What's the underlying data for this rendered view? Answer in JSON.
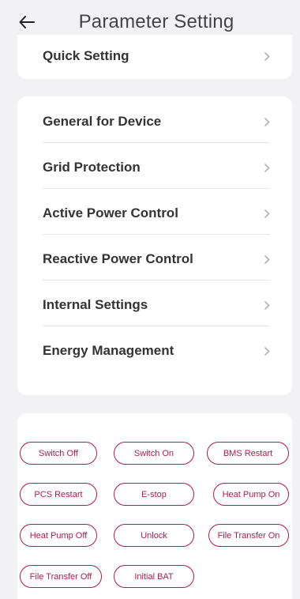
{
  "header": {
    "title": "Parameter Setting"
  },
  "quick_setting": {
    "label": "Quick Setting"
  },
  "menu": {
    "items": [
      {
        "label": "General for Device"
      },
      {
        "label": "Grid Protection"
      },
      {
        "label": "Active Power Control"
      },
      {
        "label": "Reactive Power Control"
      },
      {
        "label": "Internal Settings"
      },
      {
        "label": "Energy Management"
      }
    ]
  },
  "actions": {
    "buttons": [
      {
        "label": "Switch Off"
      },
      {
        "label": "Switch On"
      },
      {
        "label": "BMS Restart"
      },
      {
        "label": "PCS Restart"
      },
      {
        "label": "E-stop"
      },
      {
        "label": "Heat Pump On"
      },
      {
        "label": "Heat Pump Off"
      },
      {
        "label": "Unlock"
      },
      {
        "label": "File Transfer On"
      },
      {
        "label": "File Transfer Off"
      },
      {
        "label": "Initial BAT"
      }
    ]
  },
  "colors": {
    "accent": "#b01c4a",
    "background": "#f2f2f4",
    "card": "#ffffff"
  },
  "icons": {
    "back": "back-arrow-icon",
    "chevron": "chevron-right-icon"
  }
}
